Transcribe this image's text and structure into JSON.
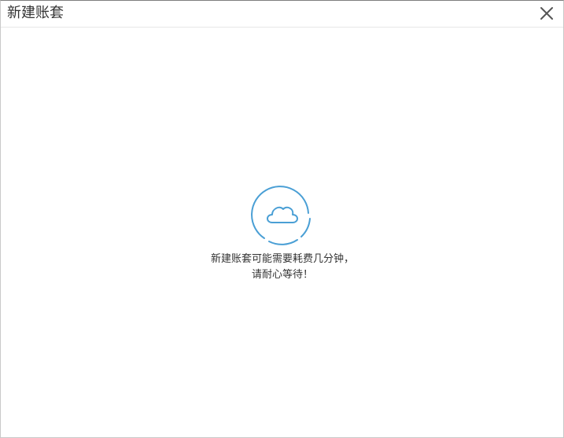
{
  "dialog": {
    "title": "新建账套",
    "close_icon": "close-icon"
  },
  "loading": {
    "icon": "cloud-icon",
    "accent_color": "#4a9fd5",
    "message_line1": "新建账套可能需要耗费几分钟，",
    "message_line2": "请耐心等待！"
  }
}
